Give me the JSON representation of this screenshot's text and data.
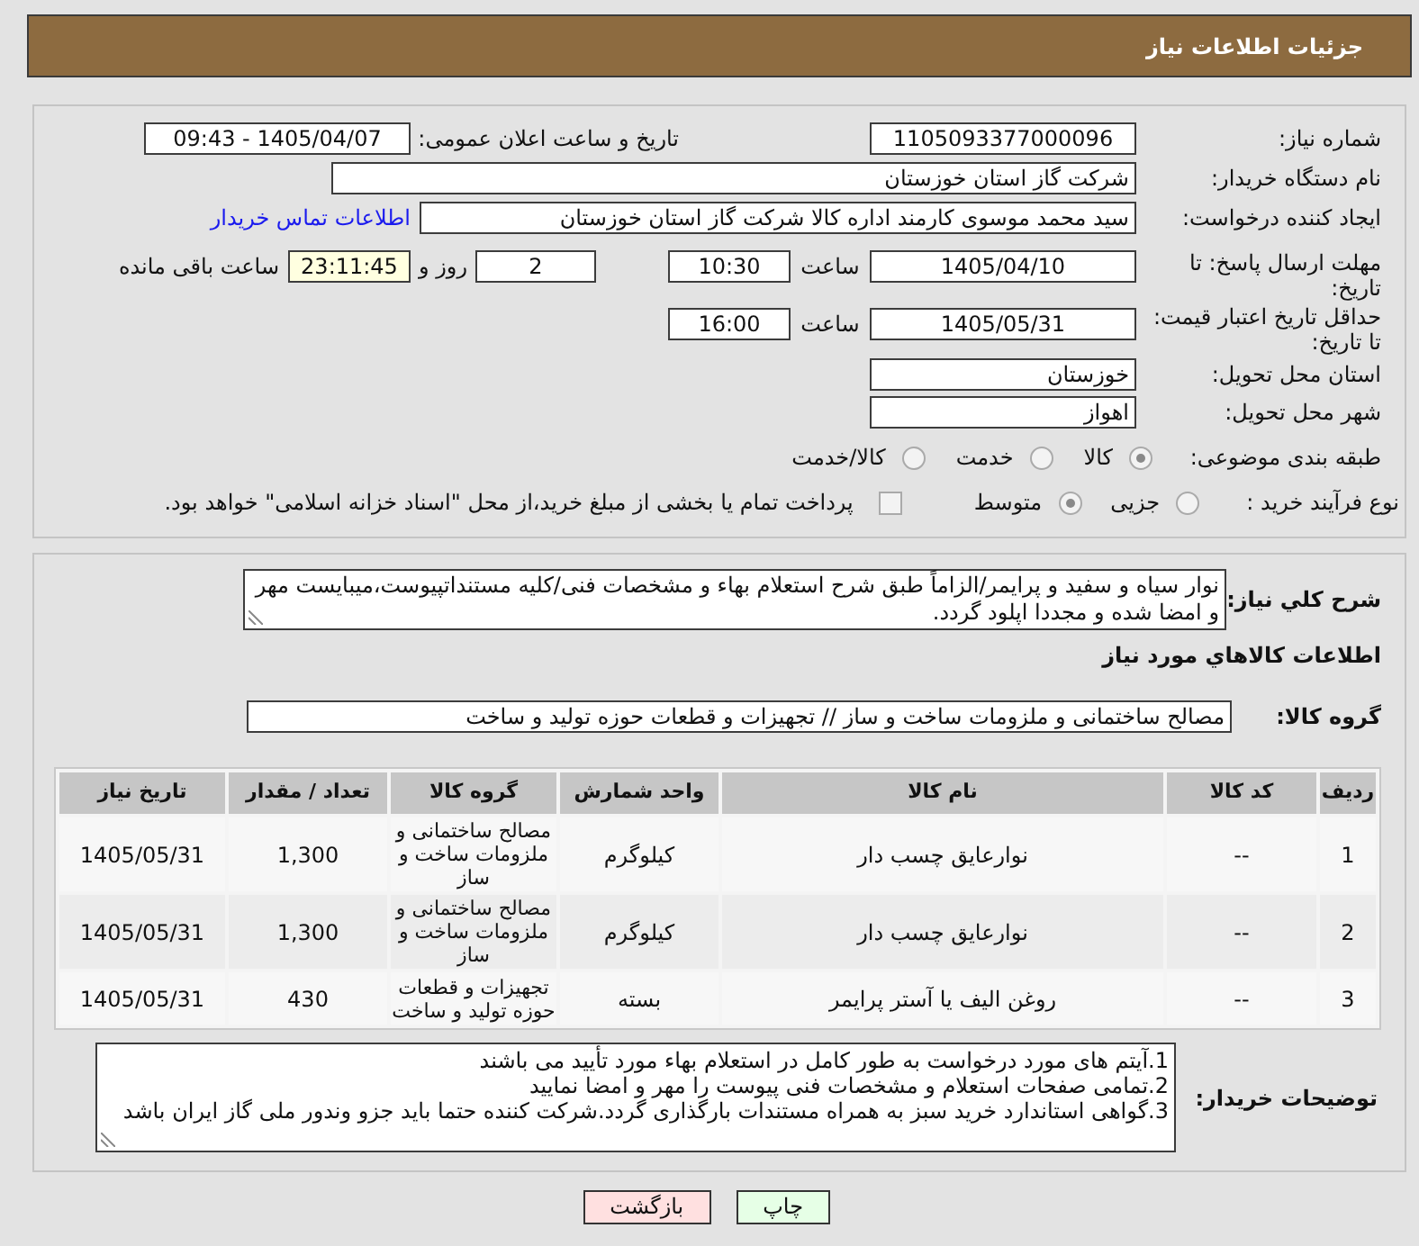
{
  "header": {
    "title": "جزئیات اطلاعات نیاز"
  },
  "details": {
    "need_number": {
      "label": "شماره نیاز:",
      "value": "1105093377000096"
    },
    "announce_datetime": {
      "label": "تاریخ و ساعت اعلان عمومی:",
      "value": "1405/04/07 - 09:43"
    },
    "buyer_org": {
      "label": "نام دستگاه خریدار:",
      "value": "شرکت گاز استان خوزستان"
    },
    "requester": {
      "label": "ایجاد کننده درخواست:",
      "value": "سید محمد موسوی کارمند اداره کالا شرکت گاز استان خوزستان",
      "contact_link": "اطلاعات تماس خریدار"
    },
    "reply_deadline": {
      "label": "مهلت ارسال پاسخ: تا تاریخ:",
      "date": "1405/04/10",
      "time_label": "ساعت",
      "time": "10:30",
      "days": "2",
      "days_label": "روز و",
      "remaining": "23:11:45",
      "remaining_label": "ساعت باقی مانده"
    },
    "price_validity": {
      "label": "حداقل تاریخ اعتبار قیمت: تا تاریخ:",
      "date": "1405/05/31",
      "time_label": "ساعت",
      "time": "16:00"
    },
    "delivery_province": {
      "label": "استان محل تحویل:",
      "value": "خوزستان"
    },
    "delivery_city": {
      "label": "شهر محل تحویل:",
      "value": "اهواز"
    },
    "category": {
      "label": "طبقه بندی موضوعی:",
      "options": [
        {
          "label": "کالا",
          "selected": true
        },
        {
          "label": "خدمت",
          "selected": false
        },
        {
          "label": "کالا/خدمت",
          "selected": false
        }
      ]
    },
    "purchase_process": {
      "label": "نوع فرآیند خرید :",
      "options": [
        {
          "label": "جزیی",
          "selected": false
        },
        {
          "label": "متوسط",
          "selected": true
        }
      ],
      "treasury_payment": {
        "label": "پرداخت تمام یا بخشی از مبلغ خرید،از محل \"اسناد خزانه اسلامی\" خواهد بود.",
        "checked": false
      }
    }
  },
  "description": {
    "label": "شرح کلي نياز:",
    "value": "نوار سیاه و سفید و پرایمر/الزاماً طبق شرح استعلام بهاء و مشخصات فنی/کلیه مستنداتپیوست،میبایست مهر و امضا شده و مجددا اپلود گردد."
  },
  "goods": {
    "title": "اطلاعات كالاهاي مورد نياز",
    "group_label": "گروه کالا:",
    "group_value": "مصالح ساختمانی و ملزومات ساخت و ساز // تجهیزات و قطعات حوزه تولید و ساخت",
    "table": {
      "columns": [
        "ردیف",
        "کد کالا",
        "نام کالا",
        "واحد شمارش",
        "گروه کالا",
        "تعداد / مقدار",
        "تاریخ نیاز"
      ],
      "rows": [
        [
          "1",
          "--",
          "نوارعایق چسب دار",
          "کیلوگرم",
          "مصالح ساختمانی و ملزومات ساخت و ساز",
          "1,300",
          "1405/05/31"
        ],
        [
          "2",
          "--",
          "نوارعایق چسب دار",
          "کیلوگرم",
          "مصالح ساختمانی و ملزومات ساخت و ساز",
          "1,300",
          "1405/05/31"
        ],
        [
          "3",
          "--",
          "روغن الیف یا آستر پرایمر",
          "بسته",
          "تجهیزات و قطعات حوزه تولید و ساخت",
          "430",
          "1405/05/31"
        ]
      ]
    }
  },
  "buyer_notes": {
    "label": "توضیحات خریدار:",
    "lines": [
      "1.آیتم های مورد درخواست به طور کامل در استعلام بهاء مورد تأیید می باشند",
      "2.تمامی صفحات استعلام و مشخصات فنی پیوست را مهر و امضا نمایید",
      "3.گواهی استاندارد خرید سبز به همراه مستندات بارگذاری گردد.شرکت کننده حتما باید جزو وندور ملی گاز ایران باشد"
    ]
  },
  "buttons": [
    {
      "label": "چاپ",
      "kind": "print"
    },
    {
      "label": "بازگشت",
      "kind": "back"
    }
  ]
}
